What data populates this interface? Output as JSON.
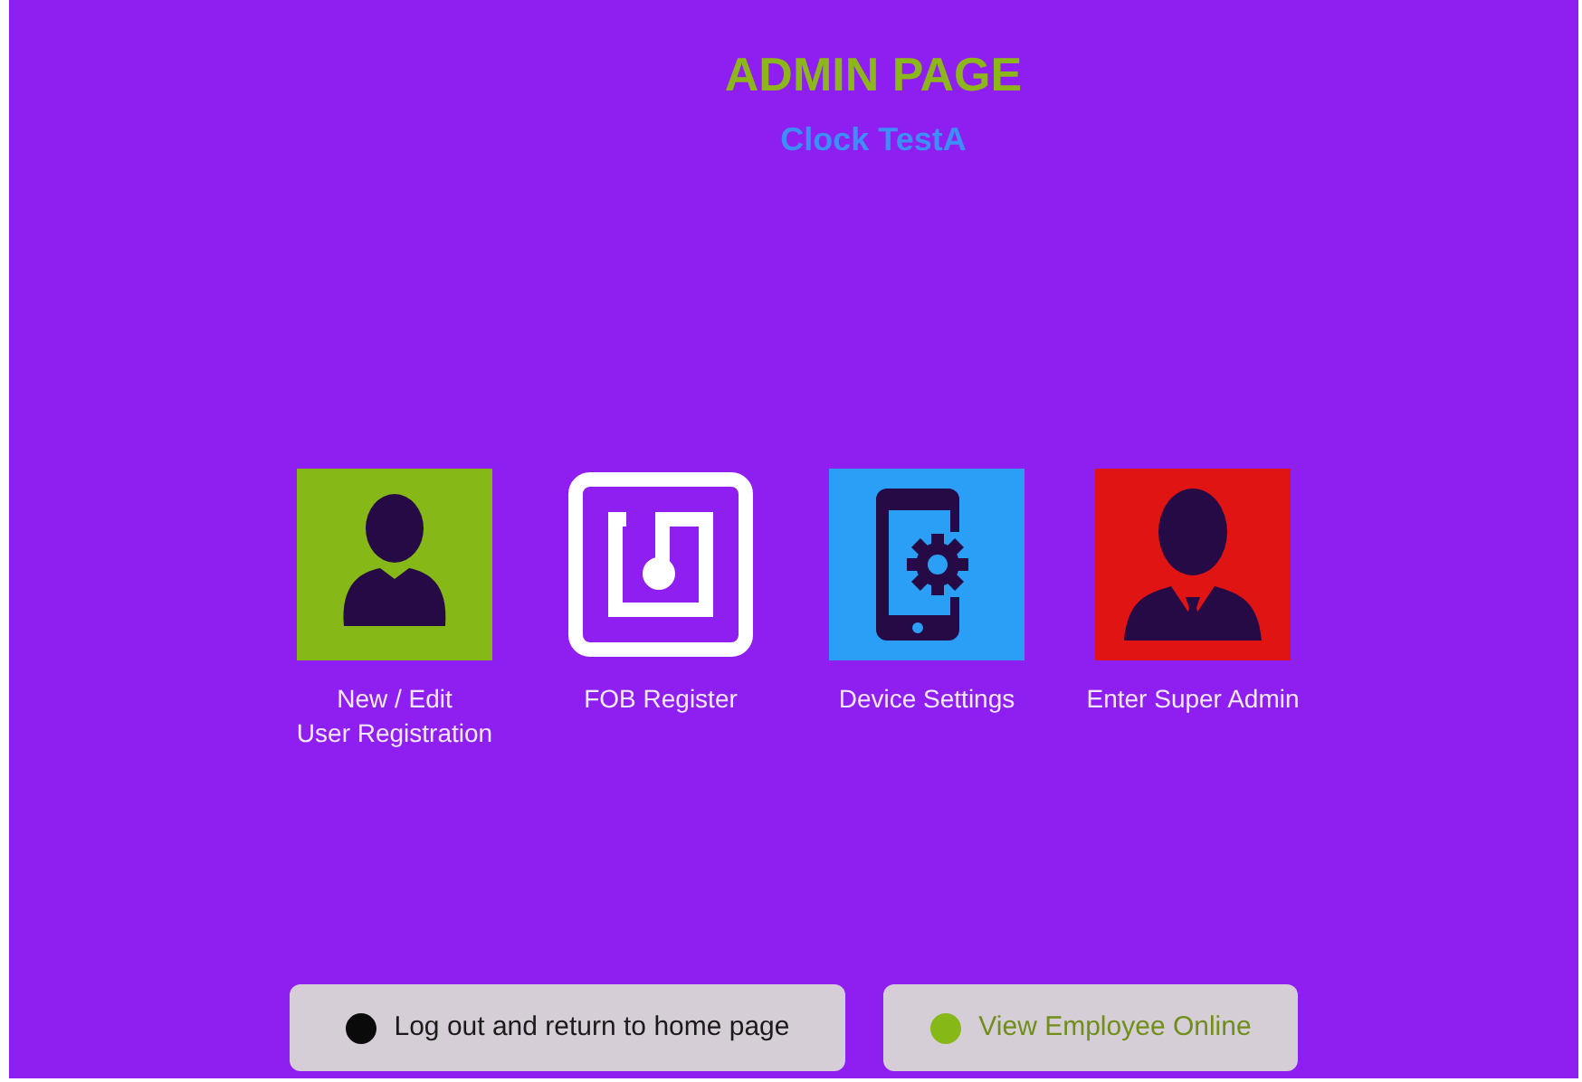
{
  "header": {
    "title": "ADMIN PAGE",
    "subtitle": "Clock TestA"
  },
  "tiles": [
    {
      "kind": "user",
      "color": "#86b817",
      "label_lines": [
        "New / Edit",
        "User Registration"
      ]
    },
    {
      "kind": "fob",
      "color": "#ffffff",
      "label_lines": [
        "FOB Register"
      ]
    },
    {
      "kind": "device",
      "color": "#2b9ef5",
      "label_lines": [
        "Device Settings"
      ]
    },
    {
      "kind": "admin",
      "color": "#e11414",
      "label_lines": [
        "Enter Super Admin"
      ]
    }
  ],
  "buttons": [
    {
      "label": "Log out and return to home page",
      "color": "#0a0a0a"
    },
    {
      "label": "View Employee Online",
      "color": "#86b817"
    }
  ]
}
